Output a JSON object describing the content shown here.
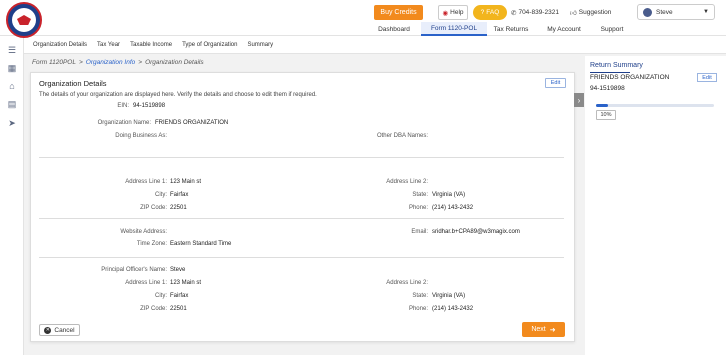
{
  "header": {
    "buy_credits": "Buy Credits",
    "help": "Help",
    "faq": "FAQ",
    "phone": "704-839-2321",
    "suggestion": "Suggestion",
    "user": "Steve"
  },
  "nav": {
    "dashboard": "Dashboard",
    "form": "Form 1120-POL",
    "tax_returns": "Tax Returns",
    "my_account": "My Account",
    "support": "Support"
  },
  "subtabs": [
    "Organization Details",
    "Tax Year",
    "Taxable Income",
    "Type of Organization",
    "Summary"
  ],
  "breadcrumb": {
    "root": "Form 1120POL",
    "sep": ">",
    "info": "Organization Info",
    "current": "Organization Details"
  },
  "card": {
    "title": "Organization Details",
    "edit": "Edit",
    "description": "The details of your organization are displayed here. Verify the details and choose to edit them if required.",
    "ein_label": "EIN:",
    "ein": "94-1519898",
    "org_name_label": "Organization Name:",
    "org_name": "FRIENDS ORGANIZATION",
    "dba_label": "Doing Business As:",
    "other_dba_label": "Other DBA Names:",
    "addr1_label": "Address Line 1:",
    "addr1": "123 Main st",
    "addr2_label": "Address Line 2:",
    "city_label": "City:",
    "city": "Fairfax",
    "state_label": "State:",
    "state": "Virginia (VA)",
    "zip_label": "ZIP Code:",
    "zip": "22501",
    "phone_label": "Phone:",
    "phone": "(214) 143-2432",
    "website_label": "Website Address:",
    "email_label": "Email:",
    "email": "sridhar.b+CPA89@w3magix.com",
    "tz_label": "Time Zone:",
    "tz": "Eastern Standard Time",
    "po_label": "Principal Officer's Name:",
    "po": "Steve",
    "po_addr1": "123 Main st",
    "po_city": "Fairfax",
    "po_state": "Virginia (VA)",
    "po_zip": "22501",
    "po_phone": "(214) 143-2432",
    "cancel": "Cancel",
    "next": "Next"
  },
  "return_summary": {
    "title": "Return Summary",
    "org": "FRIENDS ORGANIZATION",
    "ein": "94-1519898",
    "edit": "Edit",
    "progress_label": "10%",
    "progress": 0.1
  },
  "colors": {
    "accent_orange": "#f28a1d",
    "brand_blue": "#1f3f8a",
    "link_blue": "#2a62c9"
  }
}
